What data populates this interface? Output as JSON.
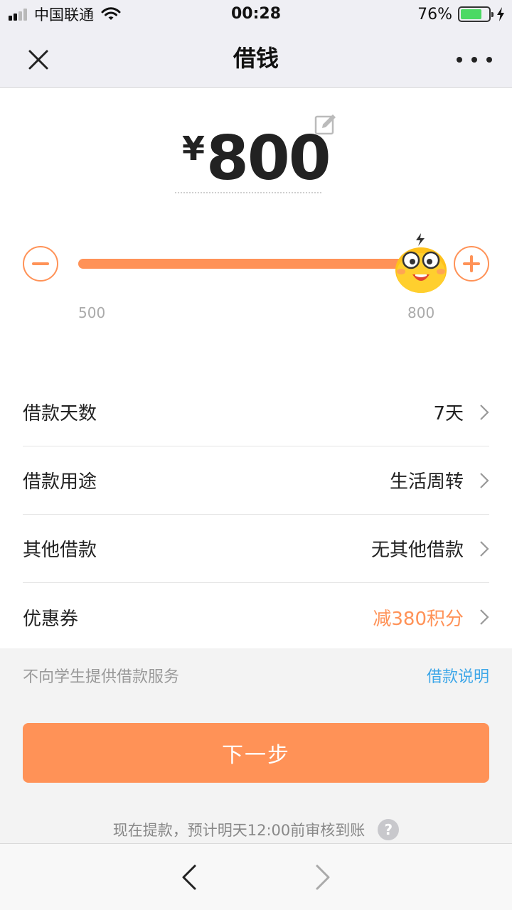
{
  "status_bar": {
    "carrier": "中国联通",
    "time": "00:28",
    "battery_text": "76%",
    "battery_level": 0.76,
    "signal_bars": 4,
    "signal_active": 2
  },
  "nav": {
    "title": "借钱",
    "close_icon": "close-icon",
    "more_icon": "more-icon"
  },
  "loan": {
    "currency": "¥",
    "amount": "800",
    "slider": {
      "min_label": "500",
      "max_label": "800",
      "min": 500,
      "max": 800,
      "value": 800
    }
  },
  "rows": [
    {
      "label": "借款天数",
      "value": "7天",
      "accent": false
    },
    {
      "label": "借款用途",
      "value": "生活周转",
      "accent": false
    },
    {
      "label": "其他借款",
      "value": "无其他借款",
      "accent": false
    },
    {
      "label": "优惠券",
      "value": "减380积分",
      "accent": true
    }
  ],
  "tips": {
    "notice": "不向学生提供借款服务",
    "link": "借款说明"
  },
  "next_button": "下一步",
  "note": "现在提款，预计明天12:00前审核到账",
  "colors": {
    "accent": "#ff9257",
    "link": "#3ea7e8"
  }
}
